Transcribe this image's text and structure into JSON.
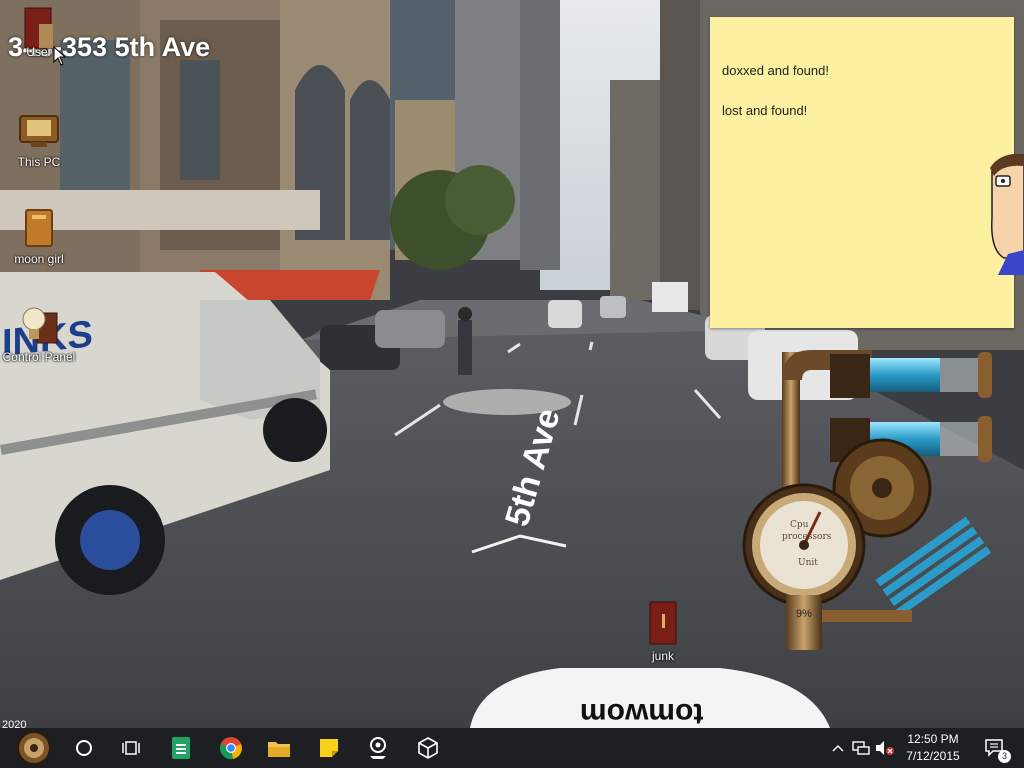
{
  "wallpaper": {
    "address": "343-353 5th Ave",
    "avenue_label": "5th Ave",
    "year_label": "2020",
    "truck_text": "INKS",
    "roof_text": "tomwom"
  },
  "desktop_icons": [
    {
      "label": "User",
      "icon": "user-folder-icon"
    },
    {
      "label": "This PC",
      "icon": "computer-chest-icon"
    },
    {
      "label": "moon girl",
      "icon": "folder-icon"
    },
    {
      "label": "Control Panel",
      "icon": "lightbulb-icon"
    },
    {
      "label": "junk",
      "icon": "folder-icon"
    }
  ],
  "sticky_note": {
    "lines": [
      "doxxed and found!",
      "lost and found!"
    ]
  },
  "gadget": {
    "gauge_label_top": "Cpu",
    "gauge_label_mid": "processors",
    "gauge_label_bottom": "Unit",
    "cpu_percent": "9%"
  },
  "taskbar": {
    "start_icon": "steampunk-start-icon",
    "pinned": [
      {
        "name": "cortana-circle-icon"
      },
      {
        "name": "task-view-icon"
      },
      {
        "name": "sheets-icon"
      },
      {
        "name": "chrome-icon"
      },
      {
        "name": "file-explorer-icon"
      },
      {
        "name": "sticky-notes-icon"
      },
      {
        "name": "maps-app-icon"
      },
      {
        "name": "unity-icon"
      }
    ],
    "tray": {
      "clock_time": "12:50 PM",
      "clock_date": "7/12/2015",
      "notification_count": "3"
    }
  },
  "colors": {
    "taskbar": "#1e1f22",
    "sticky_note": "#fdf0a0",
    "gauge_blue": "#35b4e0"
  }
}
